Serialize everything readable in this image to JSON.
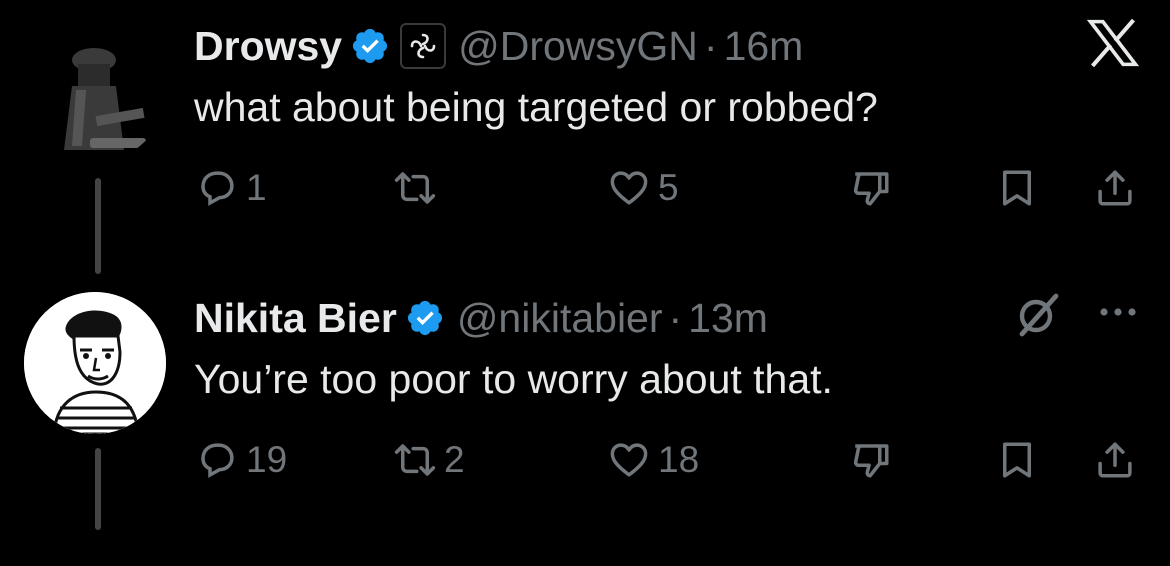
{
  "tweets": [
    {
      "display_name": "Drowsy",
      "verified": true,
      "org_badge": true,
      "handle": "@DrowsyGN",
      "separator": "·",
      "time": "16m",
      "text": "what about being targeted or robbed?",
      "actions": {
        "replies": "1",
        "reposts": "",
        "likes": "5"
      },
      "corner_icon": "x-logo-icon"
    },
    {
      "display_name": "Nikita Bier",
      "verified": true,
      "org_badge": false,
      "handle": "@nikitabier",
      "separator": "·",
      "time": "13m",
      "text": "You’re too poor to worry about that.",
      "actions": {
        "replies": "19",
        "reposts": "2",
        "likes": "18"
      },
      "corner_icon": "grok-icon"
    }
  ],
  "colors": {
    "background": "#000000",
    "text": "#e7e9ea",
    "muted": "#71767b",
    "verified": "#1d9bf0"
  }
}
